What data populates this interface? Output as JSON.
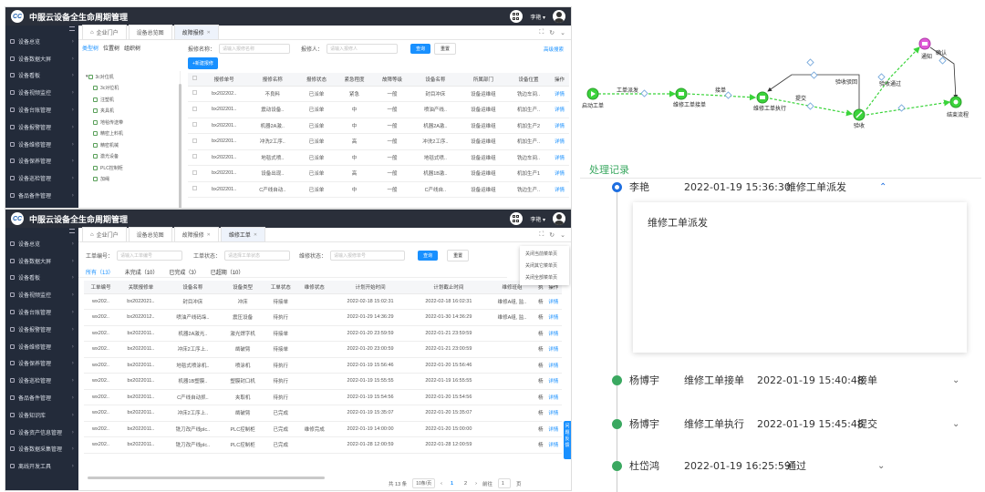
{
  "app": {
    "logo_text": "CC",
    "title": "中服云设备全生命周期管理",
    "user": "李艳 ▾"
  },
  "sidebar1": [
    "设备总览",
    "设备数据大屏",
    "设备看板",
    "设备视频监控",
    "设备台账管理",
    "设备报警管理",
    "设备维修管理",
    "设备保养管理",
    "设备巡检管理",
    "备品备件管理"
  ],
  "sidebar2": [
    "设备总览",
    "设备数据大屏",
    "设备看板",
    "设备视频监控",
    "设备台账管理",
    "设备报警管理",
    "设备维修管理",
    "设备保养管理",
    "设备巡检管理",
    "备品备件管理",
    "设备知识库",
    "设备资产信息管理",
    "设备数据采集管理",
    "离线开发工具"
  ],
  "w1": {
    "tabs": [
      "企业门户",
      "设备总览图",
      "故障报修"
    ],
    "tree_tabs": [
      "类型树",
      "位置树",
      "组织树"
    ],
    "tree": [
      "3c对位机",
      "3c对位机",
      "注塑机",
      "夹具机",
      "地毯传送带",
      "精密上料机",
      "精密机械",
      "激光设备",
      "PLC控制柜",
      "加绳"
    ],
    "search_labels": [
      "报修名称：",
      "报修人："
    ],
    "search_placeholders": [
      "请输入报修名称",
      "请输入报修人"
    ],
    "query": "查询",
    "reset": "重置",
    "advanced": "高级搜索",
    "new": "+新建报修",
    "columns": [
      "报修单号",
      "报修名称",
      "报修状态",
      "紧急程度",
      "故障等级",
      "设备名称",
      "所属部门",
      "设备位置",
      "操作"
    ],
    "rows": [
      [
        "bx202202..",
        "不良料",
        "已派单",
        "紧急",
        "一般",
        "封目冲床",
        "设备运维组",
        "铣边车间..",
        "详情"
      ],
      [
        "bx202201..",
        "震动设备..",
        "已派单",
        "中",
        "一般",
        "喷油产线..",
        "设备运维组",
        "机加生产..",
        "详情"
      ],
      [
        "bx202201..",
        "机器2A激..",
        "已派单",
        "中",
        "一般",
        "机器2A激..",
        "设备运维组",
        "机加生产2",
        "详情"
      ],
      [
        "bx202201..",
        "冲洗2工序..",
        "已派单",
        "高",
        "一般",
        "冲洗2工序..",
        "设备运维组",
        "机加生产..",
        "详情"
      ],
      [
        "bx202201..",
        "地毯式喷..",
        "已派单",
        "中",
        "一般",
        "地毯式喷..",
        "设备运维组",
        "铣边车间..",
        "详情"
      ],
      [
        "bx202201..",
        "设备出现..",
        "已派单",
        "高",
        "一般",
        "机器1B激..",
        "设备运维组",
        "机加生产1",
        "详情"
      ],
      [
        "bx202201..",
        "C产线自动..",
        "已派单",
        "中",
        "一般",
        "C产线自..",
        "设备运维组",
        "铣边生产..",
        "详情"
      ]
    ]
  },
  "w2": {
    "tabs": [
      "企业门户",
      "设备总览图",
      "故障报修",
      "维修工单"
    ],
    "search_labels": [
      "工单编号：",
      "工单状态：",
      "维修状态："
    ],
    "search_placeholders": [
      "请输入工单编号",
      "请选择工单状态",
      "请输入报修单号"
    ],
    "query": "查询",
    "reset": "重置",
    "subtabs": [
      "所有（13）",
      "未完成（10）",
      "已完成（3）",
      "已超期（10）"
    ],
    "ctx": [
      "关闭当前菜单页",
      "关闭其它菜单页",
      "关闭全部菜单页"
    ],
    "columns": [
      "工单编号",
      "关联报修单",
      "设备名称",
      "设备类型",
      "工单状态",
      "维修状态",
      "计划开始时间",
      "计划截止时间",
      "维修班组",
      "执",
      "操作"
    ],
    "rows": [
      [
        "wx202..",
        "bx2022021..",
        "封目冲床",
        "冲床",
        "待接单",
        "",
        "2022-02-18 15:02:31",
        "2022-02-18 16:02:31",
        "维修A组, 监..",
        "杨",
        "详情"
      ],
      [
        "wx202..",
        "bx2022012..",
        "喷油产线码垛..",
        "震压设备",
        "待执行",
        "",
        "2022-01-29 14:36:29",
        "2022-01-30 14:36:29",
        "维修A组, 监..",
        "杨",
        "详情"
      ],
      [
        "wx202..",
        "bx2022011..",
        "机器2A激光..",
        "激光焊字机",
        "待接单",
        "",
        "2022-01-20 23:59:59",
        "2022-01-21 23:59:59",
        "",
        "杨",
        "详情"
      ],
      [
        "wx202..",
        "bx2022011..",
        "冲床2工序上..",
        "凿破臂",
        "待接单",
        "",
        "2022-01-20 23:00:59",
        "2022-01-21 23:00:59",
        "",
        "杨",
        "详情"
      ],
      [
        "wx202..",
        "bx2022011..",
        "地毯式喷涂机..",
        "喷涂机",
        "待执行",
        "",
        "2022-01-19 15:56:46",
        "2022-01-20 15:56:46",
        "",
        "杨",
        "详情"
      ],
      [
        "wx202..",
        "bx2022011..",
        "机器1B塑膜..",
        "塑膜封口机",
        "待执行",
        "",
        "2022-01-19 15:55:55",
        "2022-01-19 16:55:55",
        "",
        "杨",
        "详情"
      ],
      [
        "wx202..",
        "bx2022011..",
        "C产线自动抓..",
        "夹取机",
        "待执行",
        "",
        "2022-01-19 15:54:56",
        "2022-01-20 15:54:56",
        "",
        "杨",
        "详情"
      ],
      [
        "wx202..",
        "bx2022011..",
        "冲床2工序上..",
        "凿破臂",
        "已完成",
        "",
        "2022-01-19 15:35:07",
        "2022-01-20 15:35:07",
        "",
        "杨",
        "详情"
      ],
      [
        "wx202..",
        "bx2022011..",
        "铣刀改产线plc..",
        "PLC控制柜",
        "已完成",
        "维修完成",
        "2022-01-19 14:00:00",
        "2022-01-20 15:00:00",
        "",
        "杨",
        "详情"
      ],
      [
        "wx202..",
        "bx2022011..",
        "铣刀改产线plc..",
        "PLC控制柜",
        "已完成",
        "",
        "2022-01-28 12:00:59",
        "2022-01-28 12:00:59",
        "",
        "杨",
        "详情"
      ]
    ],
    "pager": {
      "total": "共 13 条",
      "size": "10条/页",
      "pages": [
        "1",
        "2"
      ],
      "goto": "前往",
      "goto_val": "1",
      "page_unit": "页"
    },
    "float_tag": "问题反馈"
  },
  "flow": {
    "nodes": [
      "启动工单",
      "维修工单接单",
      "维修工单执行",
      "验收",
      "通知",
      "结束流程"
    ],
    "edges": [
      "工单派发",
      "接单",
      "提交",
      "验收驳回",
      "验收通过",
      "确认"
    ]
  },
  "history": {
    "title": "处理记录",
    "rows": [
      {
        "name": "李艳",
        "time": "2022-01-19 15:36:30",
        "action": "维修工单派发"
      },
      {
        "name": "杨博宇",
        "step": "维修工单接单",
        "time": "2022-01-19 15:40:48",
        "action": "接单"
      },
      {
        "name": "杨博宇",
        "step": "维修工单执行",
        "time": "2022-01-19 15:45:48",
        "action": "提交"
      },
      {
        "name": "杜岱鸿",
        "time": "2022-01-19 16:25:59",
        "action": "通过"
      }
    ],
    "card_text": "维修工单派发"
  },
  "colors": {
    "accent": "#1890ff",
    "green": "#3aa860",
    "sidebar": "#232b3a",
    "topbar": "#2a2f3a"
  }
}
